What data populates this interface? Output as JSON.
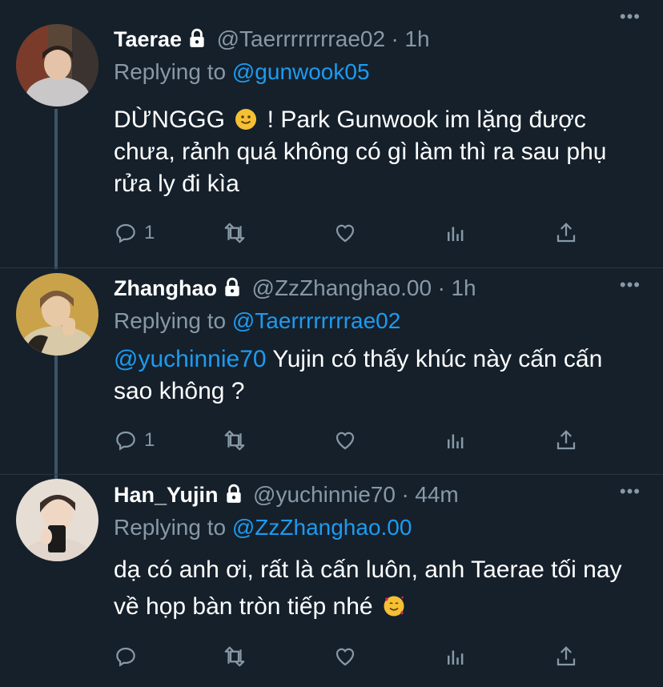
{
  "tweets": [
    {
      "display_name": "Taerae",
      "handle": "@Taerrrrrrrrae02",
      "time": "1h",
      "replying_prefix": "Replying to",
      "replying_to": "@gunwook05",
      "text_before_emoji": "DỪNGGG",
      "emoji": "slightly-smiling-face",
      "text_after_emoji": "! Park Gunwook im lặng được chưa, rảnh quá không có gì làm thì ra sau phụ rửa ly đi kìa",
      "reply_count": "1",
      "protected": true
    },
    {
      "display_name": "Zhanghao",
      "handle": "@ZzZhanghao.00",
      "time": "1h",
      "replying_prefix": "Replying to",
      "replying_to": "@Taerrrrrrrrae02",
      "mention": "@yuchinnie70",
      "text": "Yujin có thấy khúc này cấn cấn sao không ?",
      "reply_count": "1",
      "protected": true
    },
    {
      "display_name": "Han_Yujin",
      "handle": "@yuchinnie70",
      "time": "44m",
      "replying_prefix": "Replying to",
      "replying_to": "@ZzZhanghao.00",
      "text": "dạ có anh ơi, rất là cấn luôn, anh Taerae tối nay về họp bàn tròn tiếp nhé",
      "emoji": "smiling-face-with-hearts",
      "reply_count": "",
      "protected": true
    }
  ],
  "separator": "·",
  "more_label": "•••",
  "colors": {
    "background": "#15202b",
    "link": "#1d9bf0",
    "secondary": "#8899a6",
    "primary_text": "#ffffff"
  }
}
